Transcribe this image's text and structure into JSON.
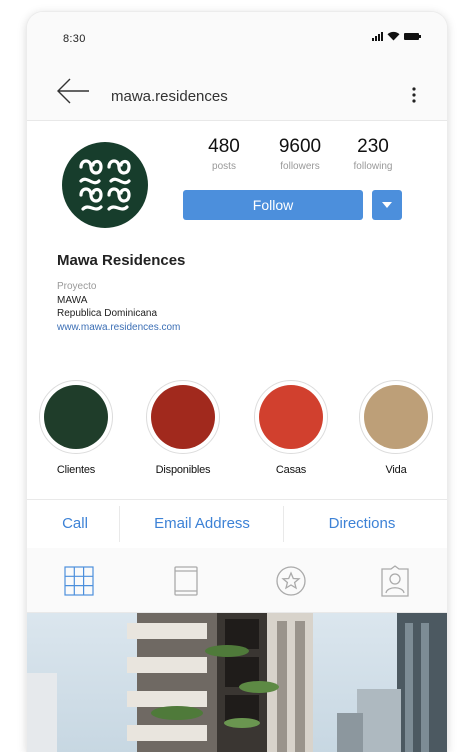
{
  "status_bar": {
    "time": "8:30"
  },
  "header": {
    "title": "mawa.residences"
  },
  "profile": {
    "stats": [
      {
        "count": "480",
        "label": "posts"
      },
      {
        "count": "9600",
        "label": "followers"
      },
      {
        "count": "230",
        "label": "following"
      }
    ],
    "follow_label": "Follow",
    "name": "Mawa Residences",
    "category": "Proyecto",
    "bio_lines": [
      "MAWA",
      "Republica Dominicana"
    ],
    "website": "www.mawa.residences.com"
  },
  "highlights": [
    {
      "label": "Clientes",
      "color": "#1f3d2a"
    },
    {
      "label": "Disponibles",
      "color": "#a1291d"
    },
    {
      "label": "Casas",
      "color": "#d1402e"
    },
    {
      "label": "Vida",
      "color": "#bd9f78"
    }
  ],
  "actions": [
    "Call",
    "Email Address",
    "Directions"
  ],
  "tabs": [
    "grid-icon",
    "tagged-posts-icon",
    "star-icon",
    "profile-tag-icon"
  ],
  "colors": {
    "accent": "#4c8fdc",
    "link": "#3d82d6",
    "avatar_bg": "#173d2c"
  }
}
